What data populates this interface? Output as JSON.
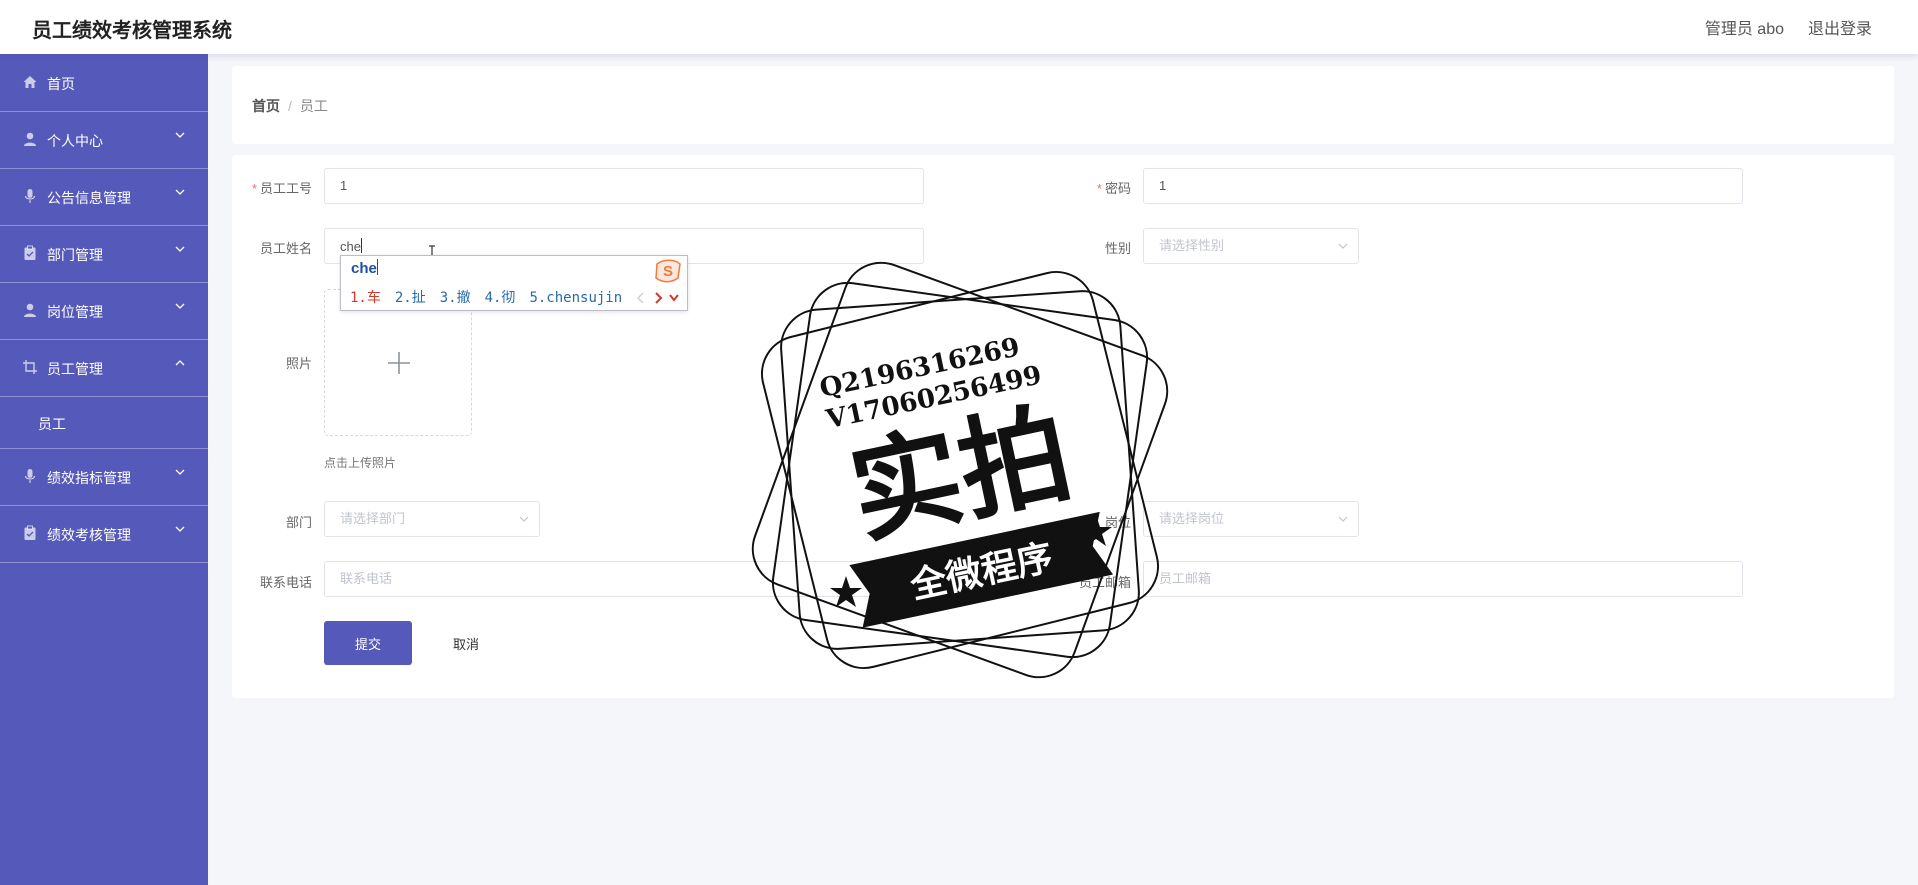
{
  "header": {
    "app_title": "员工绩效考核管理系统",
    "admin_label": "管理员 abo",
    "logout_label": "退出登录"
  },
  "sidebar": {
    "items": [
      {
        "label": "首页"
      },
      {
        "label": "个人中心"
      },
      {
        "label": "公告信息管理"
      },
      {
        "label": "部门管理"
      },
      {
        "label": "岗位管理"
      },
      {
        "label": "员工管理"
      },
      {
        "label": "绩效指标管理"
      },
      {
        "label": "绩效考核管理"
      }
    ],
    "sub_item": "员工"
  },
  "breadcrumb": {
    "home": "首页",
    "separator": "/",
    "current": "员工"
  },
  "form": {
    "employee_no": {
      "label": "员工工号",
      "value": "1"
    },
    "password": {
      "label": "密码",
      "value": "1"
    },
    "name": {
      "label": "员工姓名",
      "value": "che"
    },
    "gender": {
      "label": "性别",
      "placeholder": "请选择性别"
    },
    "photo": {
      "label": "照片",
      "hint": "点击上传照片"
    },
    "department": {
      "label": "部门",
      "placeholder": "请选择部门"
    },
    "position": {
      "label": "岗位",
      "placeholder": "请选择岗位"
    },
    "phone": {
      "label": "联系电话",
      "placeholder": "联系电话"
    },
    "email": {
      "label": "员工邮箱",
      "placeholder": "员工邮箱"
    },
    "required_mark": "*",
    "submit_label": "提交",
    "cancel_label": "取消"
  },
  "ime": {
    "composition": "che",
    "candidates": [
      "1.车",
      "2.扯",
      "3.撤",
      "4.彻",
      "5.chensujin"
    ],
    "logo_char": "S"
  },
  "watermark": {
    "line1": "Q2196316269",
    "line2": "V17060256499",
    "big_text": "实拍",
    "ribbon_text": "全微程序"
  },
  "colors": {
    "sidebar": "#5559b9",
    "primary": "#5559b9",
    "background": "#f5f6fa",
    "required": "#f56c6c",
    "ime_logo": "#f07a3c"
  }
}
